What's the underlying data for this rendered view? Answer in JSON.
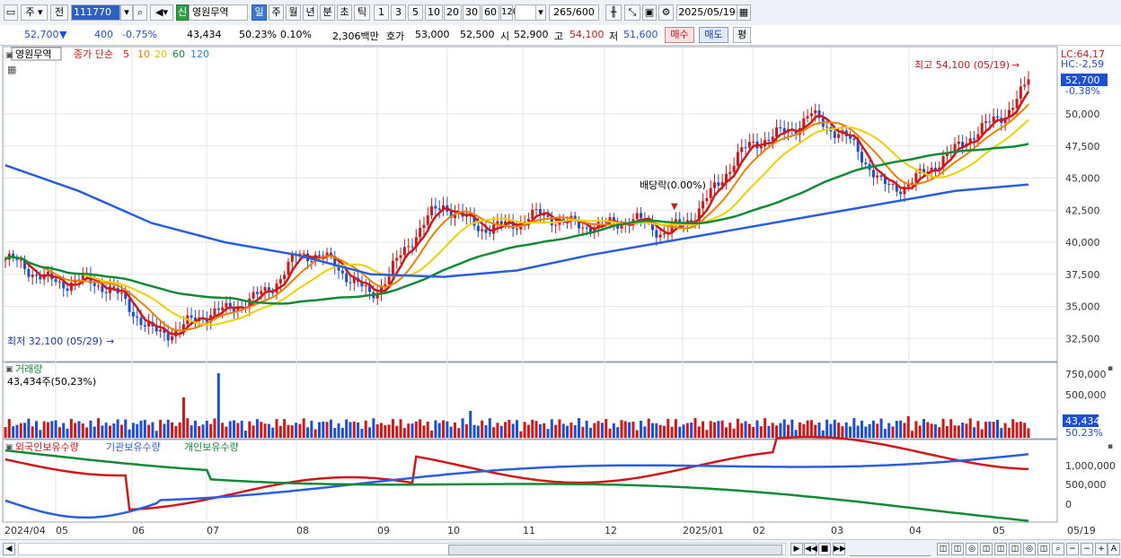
{
  "toolbar": {
    "market_tab": "주",
    "prev_tab": "전",
    "code": "111770",
    "stock_name": "영원무역",
    "badge": "신",
    "periods": [
      "일",
      "주",
      "월",
      "년",
      "분",
      "초",
      "틱"
    ],
    "active_period": "일",
    "intervals": [
      "1",
      "3",
      "5",
      "10",
      "20",
      "30",
      "60",
      "120"
    ],
    "count": "265",
    "count_total": "/600",
    "date": "2025/05/19"
  },
  "quote": {
    "price": "52,700",
    "change": "400",
    "change_pct": "-0.75%",
    "volume": "43,434",
    "vol_ratio": "50.23%",
    "turnover_pct": "0.10%",
    "amount": "2,306백만",
    "ask_label": "호가",
    "ask1": "53,000",
    "ask2": "52,500",
    "open_label": "시",
    "open": "52,900",
    "high_label": "고",
    "high": "54,100",
    "low_label": "저",
    "low": "51,600",
    "buy_button": "매수",
    "sell_button": "매도",
    "eval_button": "평"
  },
  "price_panel": {
    "name_tag": "영원무역",
    "legend_prefix": "종가 단순",
    "ma_periods": [
      "5",
      "10",
      "20",
      "60",
      "120"
    ],
    "ma_colors": [
      "#d01818",
      "#f08000",
      "#f0d000",
      "#138a36",
      "#2a5ee0"
    ],
    "y_ticks": [
      "52,700",
      "50,000",
      "47,500",
      "45,000",
      "42,500",
      "40,000",
      "37,500",
      "35,000",
      "32,500"
    ],
    "lc": "LC:64,17",
    "hc": "HC:-2,59",
    "pct": "-0.38%",
    "last_price_tag": "52,700",
    "high_note": "최고 54,100 (05/19)",
    "low_note": "최저 32,100 (05/29)",
    "dividend_note": "배당락(0.00%)"
  },
  "volume_panel": {
    "title": "거래량",
    "value": "43,434주(50,23%)",
    "y_ticks": [
      "750,000",
      "500,000",
      "250,000"
    ],
    "last_tag": "43,434",
    "last_pct": "50.23%"
  },
  "flow_panel": {
    "legend": [
      "외국인보유수량",
      "기관보유수량",
      "개인보유수량"
    ],
    "colors": [
      "#d01818",
      "#2a5ee0",
      "#138a36"
    ],
    "y_ticks": [
      "1,000,000",
      "500,000",
      "0"
    ]
  },
  "x_axis": {
    "labels": [
      "2024/04",
      "05",
      "06",
      "07",
      "08",
      "09",
      "10",
      "11",
      "12",
      "2025/01",
      "02",
      "03",
      "04",
      "05",
      "05/19"
    ]
  },
  "chart_data": {
    "type": "line",
    "title": "영원무역",
    "x": [
      "2024/04",
      "05",
      "06",
      "07",
      "08",
      "09",
      "10",
      "11",
      "12",
      "2025/01",
      "02",
      "03",
      "04",
      "05",
      "05/19"
    ],
    "series": [
      {
        "name": "종가",
        "values": [
          38000,
          37300,
          33500,
          34000,
          39000,
          36500,
          42500,
          41200,
          42000,
          40500,
          46000,
          50500,
          44500,
          46500,
          52700
        ]
      },
      {
        "name": "120",
        "values": [
          46000,
          44000,
          41500,
          40000,
          39000,
          37500,
          37300,
          37800,
          39000,
          40000,
          41000,
          42000,
          43000,
          44000,
          44500
        ]
      }
    ],
    "ylim": [
      31000,
      54500
    ]
  }
}
